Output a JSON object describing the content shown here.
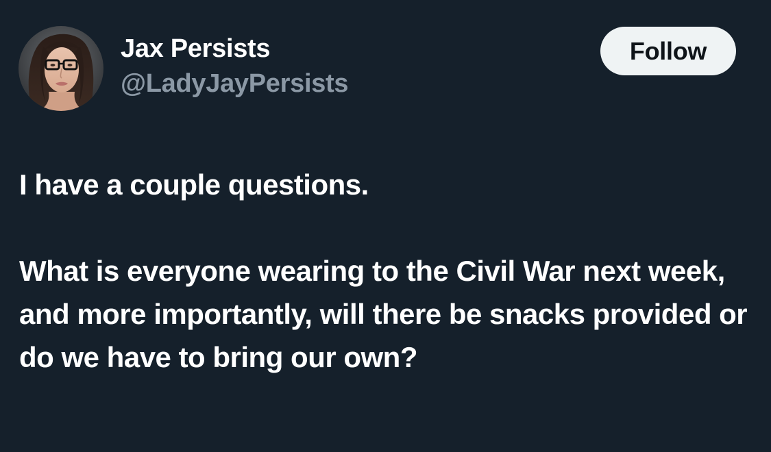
{
  "author": {
    "display_name": "Jax Persists",
    "handle": "@LadyJayPersists",
    "avatar_icon": "profile-photo-icon"
  },
  "actions": {
    "follow_label": "Follow"
  },
  "tweet": {
    "paragraphs": [
      "I have a couple questions.",
      "What is everyone wearing to the Civil War next week, and more importantly, will there be snacks provided or do we have to bring our own?"
    ]
  },
  "colors": {
    "background": "#15202b",
    "text_primary": "#ffffff",
    "text_secondary": "#8b98a5",
    "button_bg": "#eff3f4",
    "button_text": "#0f1419"
  }
}
